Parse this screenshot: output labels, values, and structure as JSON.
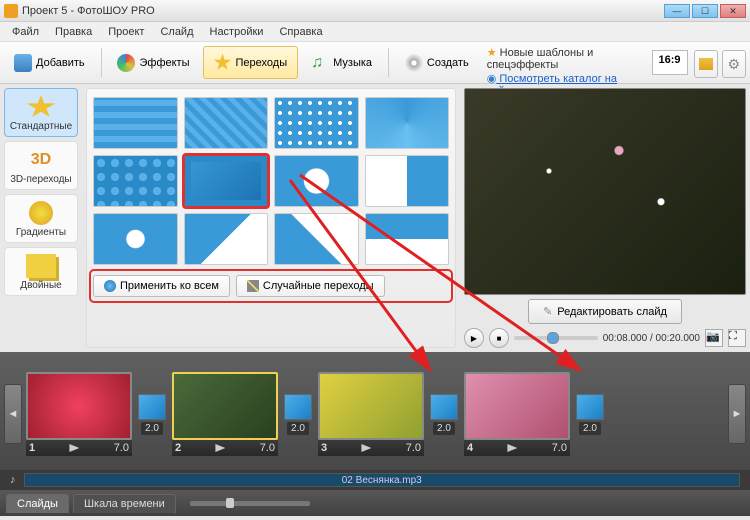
{
  "window": {
    "title": "Проект 5 - ФотоШОУ PRO"
  },
  "menu": [
    "Файл",
    "Правка",
    "Проект",
    "Слайд",
    "Настройки",
    "Справка"
  ],
  "toolbar": {
    "add": "Добавить",
    "effects": "Эффекты",
    "transitions": "Переходы",
    "music": "Музыка",
    "create": "Создать"
  },
  "info": {
    "line1": "Новые шаблоны и спецэффекты",
    "line2": "Посмотреть каталог на сайте…"
  },
  "aspect": "16:9",
  "categories": [
    {
      "label": "Стандартные",
      "sel": true
    },
    {
      "label": "3D-переходы"
    },
    {
      "label": "Градиенты"
    },
    {
      "label": "Двойные"
    }
  ],
  "actions": {
    "apply_all": "Применить ко всем",
    "random": "Случайные переходы"
  },
  "preview": {
    "edit": "Редактировать слайд",
    "time": "00:08.000 / 00:20.000"
  },
  "timeline": {
    "slides": [
      {
        "n": "1",
        "dur": "7.0",
        "trans": "2.0",
        "bg": "radial-gradient(circle,#f04060,#a02030)"
      },
      {
        "n": "2",
        "dur": "7.0",
        "trans": "2.0",
        "bg": "linear-gradient(135deg,#4a6a3a,#2a4020)",
        "sel": true
      },
      {
        "n": "3",
        "dur": "7.0",
        "trans": "2.0",
        "bg": "linear-gradient(135deg,#e0d040,#90a030)"
      },
      {
        "n": "4",
        "dur": "7.0",
        "trans": "2.0",
        "bg": "linear-gradient(135deg,#e090b0,#b05070)"
      }
    ]
  },
  "audio": {
    "track": "02 Веснянка.mp3",
    "icon": "♪"
  },
  "bottom": {
    "slides": "Слайды",
    "timeline": "Шкала времени"
  }
}
